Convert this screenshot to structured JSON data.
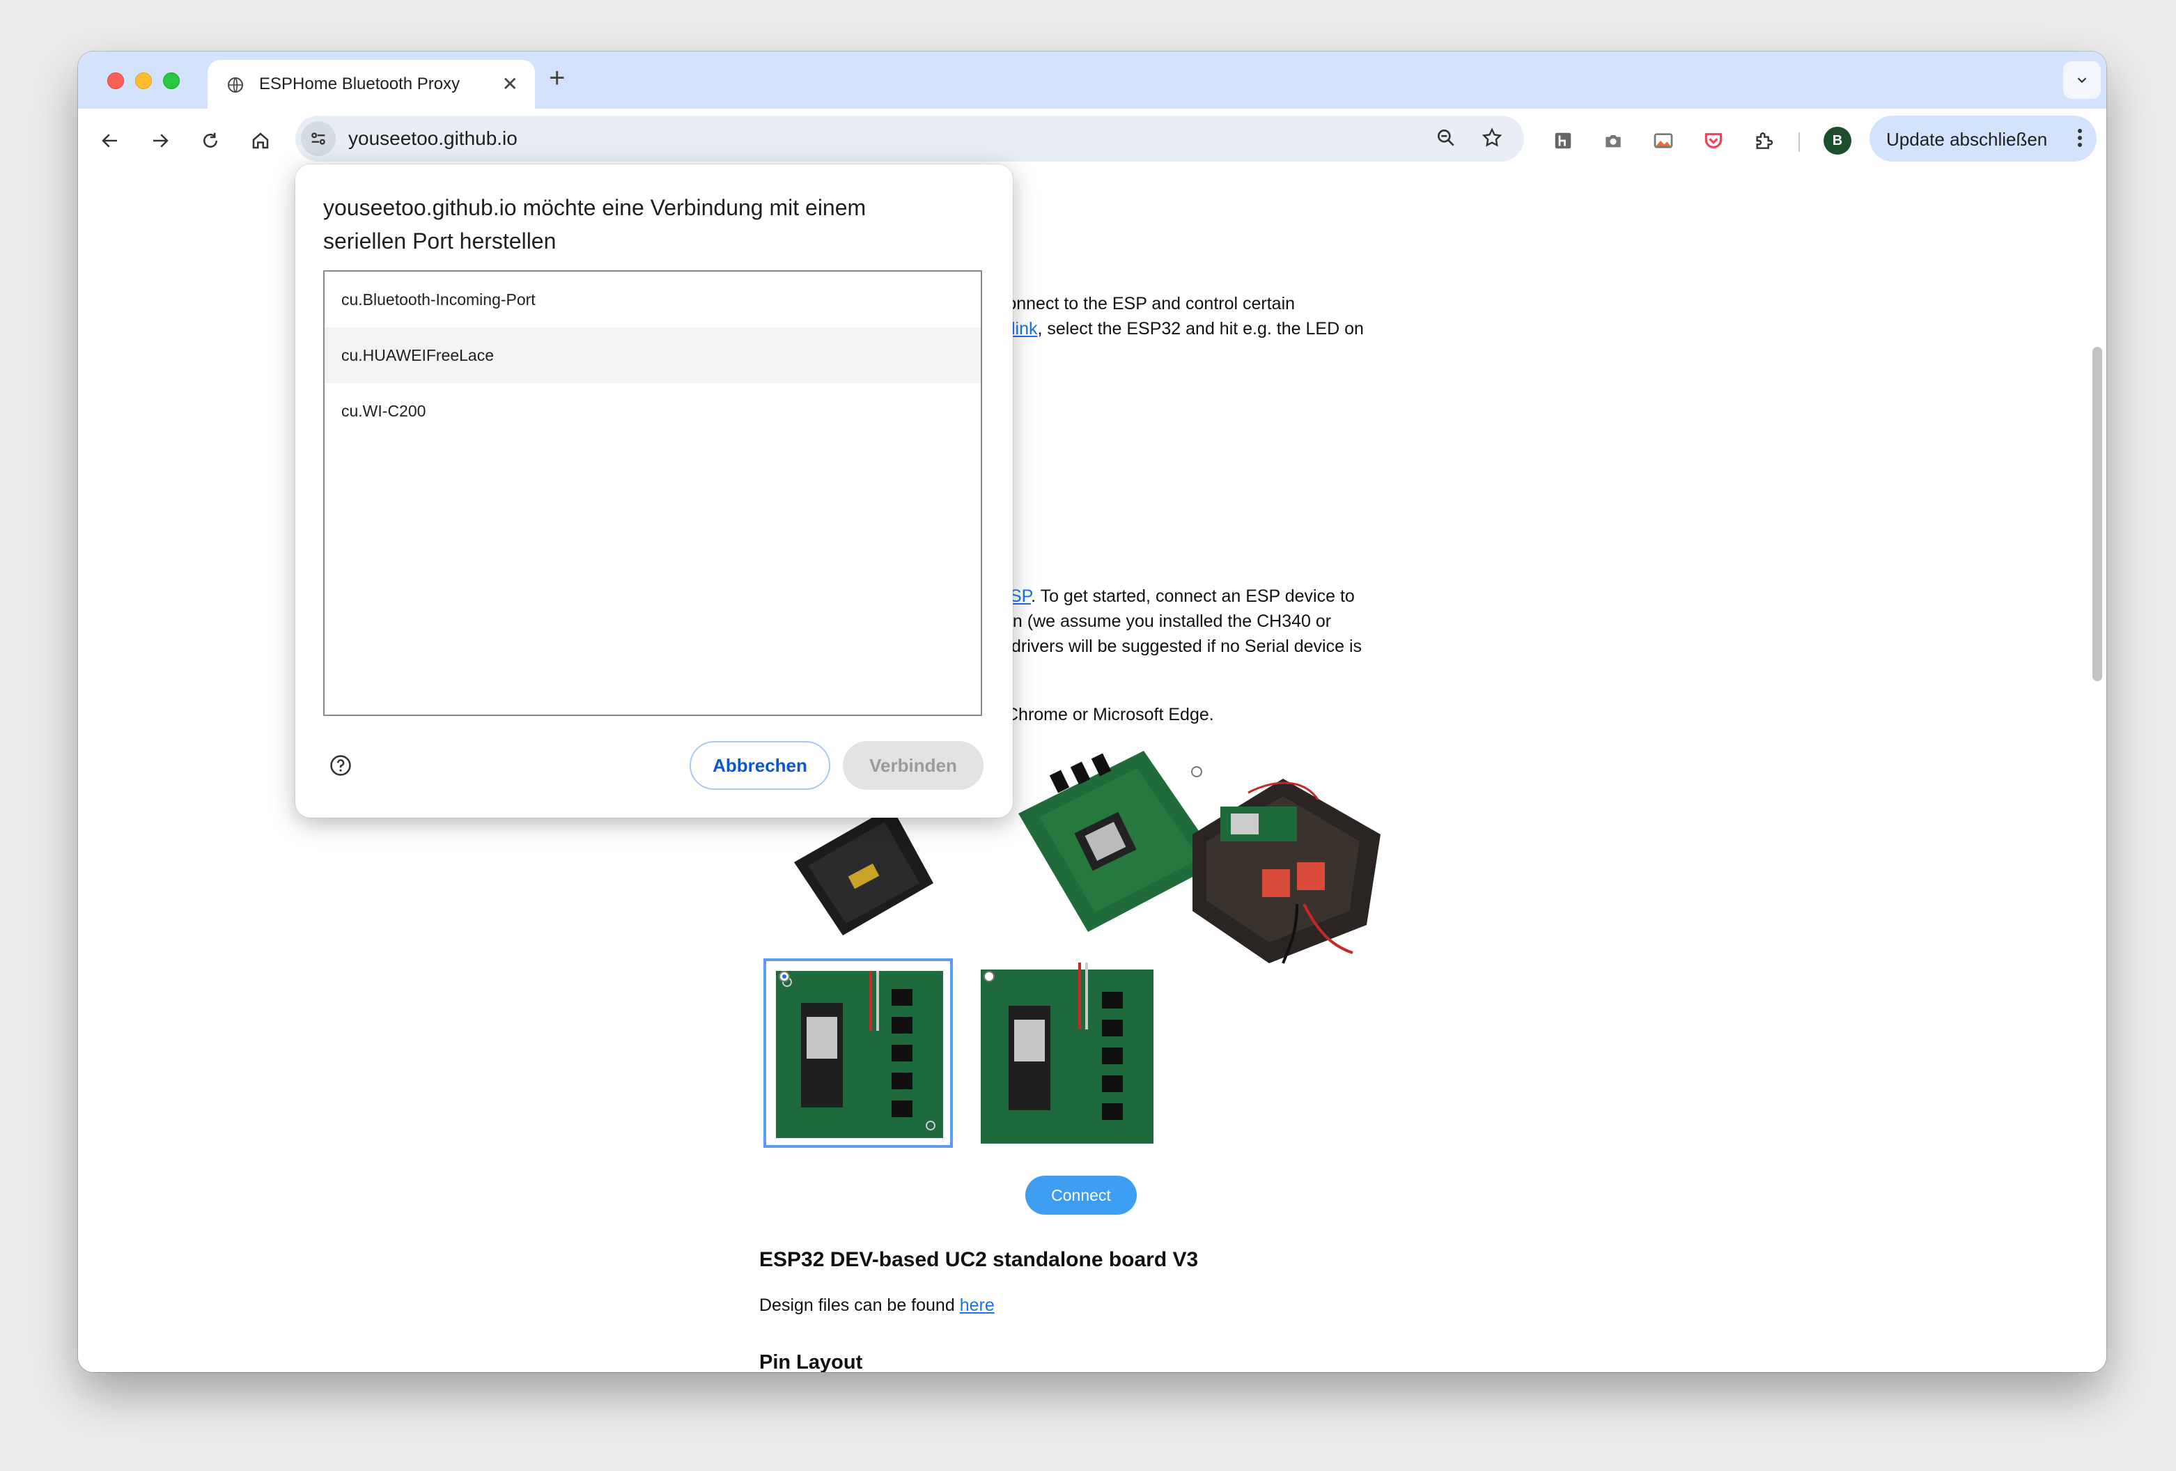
{
  "browser": {
    "tab_title": "ESPHome Bluetooth Proxy",
    "tab_close": "✕",
    "new_tab": "+",
    "url": "youseetoo.github.io",
    "update_label": "Update abschließen",
    "avatar_initial": "B"
  },
  "page": {
    "para1_line1": "o connect to the ESP and control certain",
    "para1_link": "link",
    "para1_line2_rest": ", select the ESP32 and hit e.g. the LED on",
    "para2_link": "SP",
    "para2_line1_rest": ". To get started, connect an ESP device to",
    "para2_line2": "on (we assume you installed the CH340 or",
    "para2_line3": "drivers will be suggested if no Serial device is",
    "para3": "Chrome or Microsoft Edge.",
    "connect_button": "Connect",
    "board_heading": "ESP32 DEV-based UC2 standalone board V3",
    "design_text": "Design files can be found ",
    "design_link": "here",
    "pin_heading": "Pin Layout"
  },
  "dialog": {
    "title": "youseetoo.github.io möchte eine Verbindung mit einem seriellen Port herstellen",
    "ports": [
      "cu.Bluetooth-Incoming-Port",
      "cu.HUAWEIFreeLace",
      "cu.WI-C200"
    ],
    "highlighted_port": "cu.HUAWEIFreeLace",
    "cancel_label": "Abbrechen",
    "connect_label": "Verbinden"
  },
  "colors": {
    "tabstrip": "#d3e3fd",
    "accent": "#0b57d0",
    "connect_button": "#3d9df0",
    "link": "#1a73e8"
  }
}
